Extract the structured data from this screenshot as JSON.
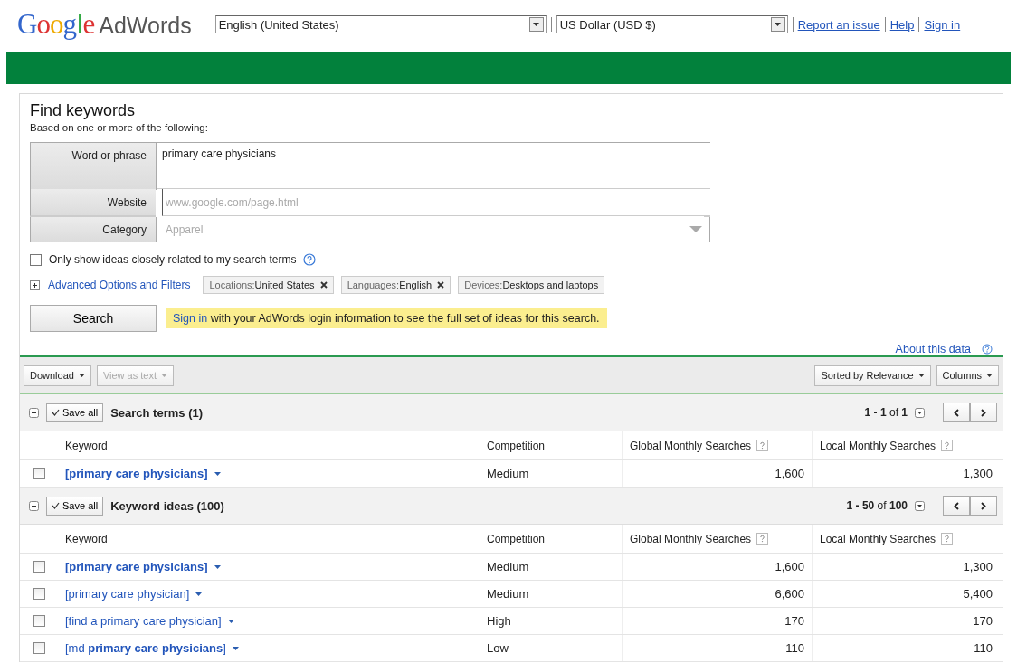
{
  "header": {
    "logo": {
      "brand": "Google",
      "product": "AdWords"
    },
    "language_select": {
      "value": "English (United States)"
    },
    "currency_select": {
      "value": "US Dollar (USD $)"
    },
    "links": [
      "Report an issue",
      "Help",
      "Sign in"
    ]
  },
  "find": {
    "title": "Find keywords",
    "subtitle": "Based on one or more of the following:",
    "fields": [
      {
        "kind": "textarea",
        "label": "Word or phrase",
        "value": "primary care physicians"
      },
      {
        "kind": "input",
        "label": "Website",
        "placeholder": "www.google.com/page.html"
      },
      {
        "kind": "select",
        "label": "Category",
        "placeholder": "Apparel"
      }
    ],
    "closely_related": {
      "label": "Only show ideas closely related to my search terms",
      "checked": false
    },
    "advanced": {
      "label": "Advanced Options and Filters",
      "expanded": false
    },
    "filters": [
      {
        "name": "Locations:",
        "value": "United States",
        "removable": true
      },
      {
        "name": "Languages:",
        "value": "English",
        "removable": true
      },
      {
        "name": "Devices:",
        "value": "Desktops and laptops",
        "removable": false
      }
    ],
    "search_button": "Search",
    "notice": {
      "link": "Sign in",
      "text": "with your AdWords login information to see the full set of ideas for this search."
    }
  },
  "results": {
    "about": "About this data",
    "toolbar": [
      {
        "label": "Download",
        "disabled": false
      },
      {
        "label": "View as text",
        "disabled": true
      }
    ],
    "toolbar_right": [
      {
        "label": "Sorted by Relevance",
        "disabled": false
      },
      {
        "label": "Columns",
        "disabled": false
      }
    ],
    "sections": [
      {
        "save_all": "Save all",
        "title": "Search terms (1)",
        "expanded": true,
        "range": "1 - 1",
        "of": "of",
        "total": "1",
        "columns": [
          "Keyword",
          "Competition",
          "Global Monthly Searches",
          "Local Monthly Searches"
        ],
        "rows": [
          {
            "keyword": "[primary care physicians]",
            "bold": true,
            "checked": false,
            "competition": "Medium",
            "global": "1,600",
            "local": "1,300"
          }
        ]
      },
      {
        "save_all": "Save all",
        "title": "Keyword ideas (100)",
        "expanded": true,
        "range": "1 - 50",
        "of": "of",
        "total": "100",
        "columns": [
          "Keyword",
          "Competition",
          "Global Monthly Searches",
          "Local Monthly Searches"
        ],
        "rows": [
          {
            "keyword": "[primary care physicians]",
            "bold": true,
            "checked": false,
            "competition": "Medium",
            "global": "1,600",
            "local": "1,300"
          },
          {
            "keyword": "[primary care physician]",
            "bold": false,
            "checked": false,
            "competition": "Medium",
            "global": "6,600",
            "local": "5,400"
          },
          {
            "keyword": "[find a primary care physician]",
            "bold": false,
            "checked": false,
            "competition": "High",
            "global": "170",
            "local": "170"
          },
          {
            "keyword": "[md **primary care physicians**]",
            "bold": false,
            "checked": false,
            "competition": "Low",
            "global": "110",
            "local": "110"
          }
        ]
      }
    ]
  }
}
